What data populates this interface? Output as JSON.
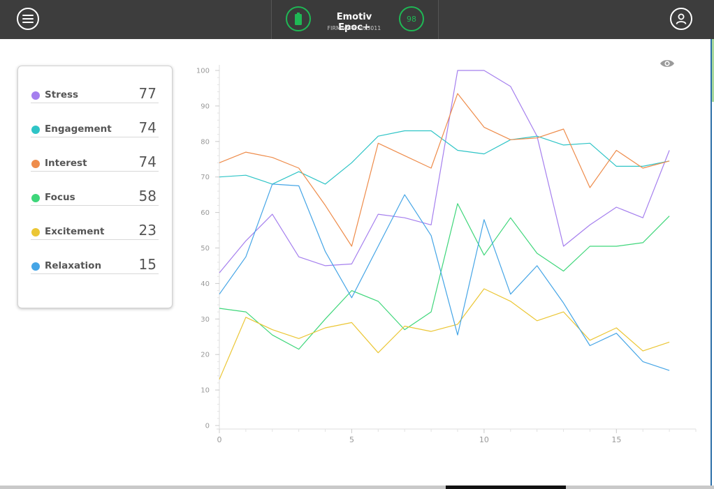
{
  "header": {
    "device_name": "Emotiv Epoc+",
    "firmware": "FIRMWARE: 0x3011",
    "signal_value": "98",
    "icons": [
      "menu-icon",
      "battery-icon",
      "user-icon"
    ]
  },
  "metrics": [
    {
      "label": "Stress",
      "value": "77",
      "color": "#a57fee"
    },
    {
      "label": "Engagement",
      "value": "74",
      "color": "#2ec4c6"
    },
    {
      "label": "Interest",
      "value": "74",
      "color": "#ee8c4b"
    },
    {
      "label": "Focus",
      "value": "58",
      "color": "#3ed67a"
    },
    {
      "label": "Excitement",
      "value": "23",
      "color": "#ebc634"
    },
    {
      "label": "Relaxation",
      "value": "15",
      "color": "#45a5e6"
    }
  ],
  "chart_data": {
    "type": "line",
    "x": [
      0,
      1,
      2,
      3,
      4,
      5,
      6,
      7,
      8,
      9,
      10,
      11,
      12,
      13,
      14,
      15,
      16,
      17
    ],
    "xlim": [
      0,
      18
    ],
    "ylim": [
      0,
      100
    ],
    "xticks": [
      0,
      5,
      10,
      15
    ],
    "yticks": [
      0,
      10,
      20,
      30,
      40,
      50,
      60,
      70,
      80,
      90,
      100
    ],
    "grid": false,
    "series": [
      {
        "name": "Stress",
        "color": "#a57fee",
        "values": [
          43,
          52,
          59.5,
          47.5,
          45,
          45.5,
          59.5,
          58.5,
          56.5,
          100,
          100,
          95.5,
          81.5,
          50.5,
          56.5,
          61.5,
          58.5,
          77.5
        ]
      },
      {
        "name": "Engagement",
        "color": "#2ec4c6",
        "values": [
          70,
          70.5,
          68,
          71.5,
          68,
          74,
          81.5,
          83,
          83,
          77.5,
          76.5,
          80.5,
          81.5,
          79,
          79.5,
          73,
          73,
          74.5
        ]
      },
      {
        "name": "Interest",
        "color": "#ee8c4b",
        "values": [
          74,
          77,
          75.5,
          72.5,
          62,
          50.5,
          79.5,
          76,
          72.5,
          93.5,
          84,
          80.5,
          81,
          83.5,
          67,
          77.5,
          72.5,
          74.5
        ]
      },
      {
        "name": "Focus",
        "color": "#3ed67a",
        "values": [
          33,
          32,
          25.5,
          21.5,
          30,
          38,
          35,
          27,
          32,
          62.5,
          48,
          58.5,
          48.5,
          43.5,
          50.5,
          50.5,
          51.5,
          59
        ]
      },
      {
        "name": "Excitement",
        "color": "#ebc634",
        "values": [
          13,
          30.5,
          27,
          24.5,
          27.5,
          29,
          20.5,
          28,
          26.5,
          28.5,
          38.5,
          35,
          29.5,
          32,
          24,
          27.5,
          21,
          23.5
        ]
      },
      {
        "name": "Relaxation",
        "color": "#45a5e6",
        "values": [
          37,
          47.5,
          68,
          67.5,
          49,
          36,
          50.5,
          65,
          53.5,
          25.5,
          58,
          37,
          45,
          34.5,
          22.5,
          26,
          18,
          15.5
        ]
      }
    ]
  }
}
